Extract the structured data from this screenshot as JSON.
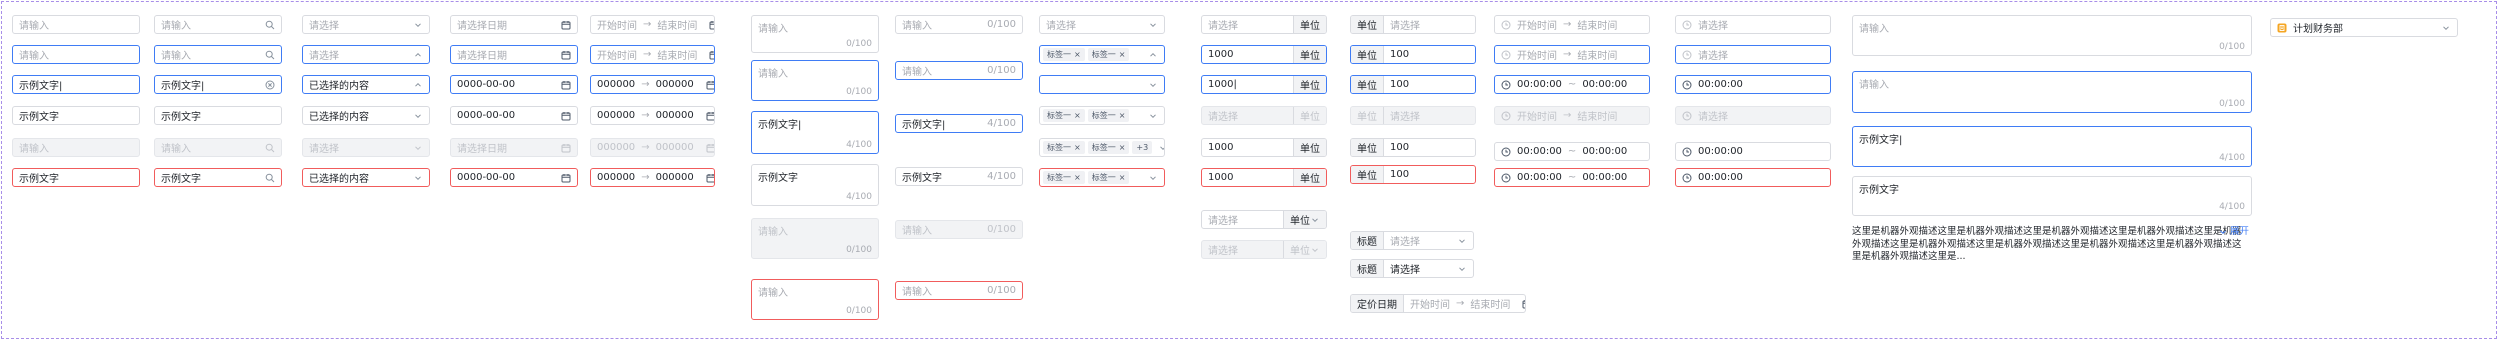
{
  "ph": {
    "input": "请输入",
    "select": "请选择",
    "date": "请选择日期",
    "start": "开始时间",
    "end": "结束时间",
    "title": "标题"
  },
  "val": {
    "sample": "示例文字",
    "sample_cursor": "示例文字|",
    "selected": "已选择的内容",
    "date": "0000-00-00",
    "range_from": "000000",
    "range_to": "000000",
    "num": "1000",
    "num_cursor": "1000|",
    "hundred": "100",
    "time": "00:00:00",
    "sep": "→",
    "tilde": "~",
    "unit": "单位",
    "tag": "标签一",
    "more": "+3",
    "title_label": "标题",
    "select_value": "请选择",
    "price_date": "定价日期",
    "expand": "展开",
    "long_text": "这里是机器外观描述这里是机器外观描述这里是机器外观描述这里是机器外观描述这里是机器外观描述这里是机器外观描述这里是机器外观描述这里是机器外观描述这里是机器外观描述这里是机器外观描述这里是...",
    "dept": "计划财务部",
    "cnt0": "0/100",
    "cnt4": "4/100"
  },
  "colors": {
    "primary": "#3f7cf5",
    "error": "#f15c5c",
    "border": "#d9dbe0",
    "disabled_bg": "#f2f3f5",
    "dept_icon": "#f5a623"
  }
}
